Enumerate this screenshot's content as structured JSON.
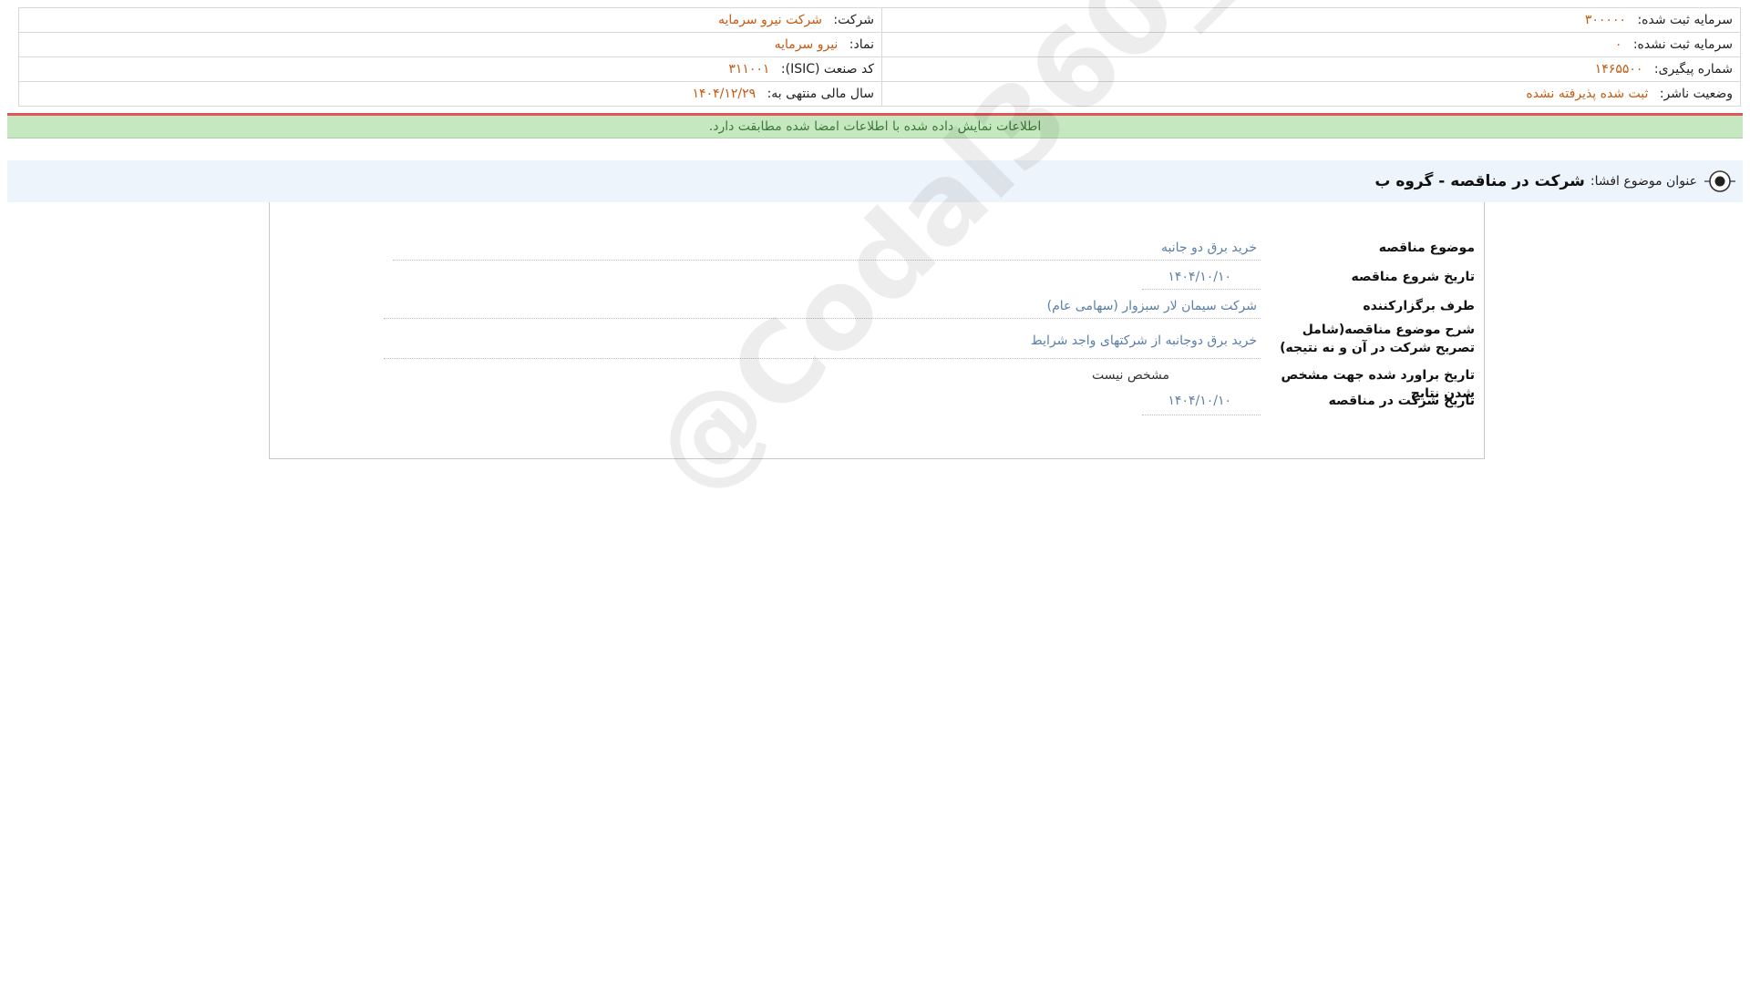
{
  "header": {
    "company_label": "شرکت:",
    "company_value": "شرکت نیرو سرمایه",
    "symbol_label": "نماد:",
    "symbol_value": "نیرو سرمایه",
    "isic_label": "کد صنعت (ISIC):",
    "isic_value": "۳۱۱۰۰۱",
    "fiscal_label": "سال مالی منتهی به:",
    "fiscal_value": "۱۴۰۴/۱۲/۲۹",
    "registered_capital_label": "سرمایه ثبت شده:",
    "registered_capital_value": "۳۰۰۰۰۰",
    "unregistered_capital_label": "سرمایه ثبت نشده:",
    "unregistered_capital_value": "۰",
    "tracking_label": "شماره پیگیری:",
    "tracking_value": "۱۴۶۵۵۰۰",
    "publisher_status_label": "وضعیت ناشر:",
    "publisher_status_value": "ثبت شده پذیرفته نشده"
  },
  "notice": {
    "text": "اطلاعات نمایش داده شده با اطلاعات امضا شده مطابقت دارد."
  },
  "subject": {
    "label": "عنوان موضوع افشا:",
    "title": "شرکت در مناقصه - گروه ب"
  },
  "details": [
    {
      "label": "موضوع مناقصه",
      "value": "خرید برق دو جانبه"
    },
    {
      "label": "تاریخ شروع مناقصه",
      "value": "۱۴۰۴/۱۰/۱۰"
    },
    {
      "label": "طرف برگزارکننده",
      "value": "شرکت سیمان لار سبزوار (سهامی عام)"
    },
    {
      "label": "شرح موضوع مناقصه(شامل تصریح شرکت در آن و نه نتیجه)",
      "value": "خرید برق دوجانبه از شرکتهای واجد شرایط"
    },
    {
      "label": "تاریخ براورد شده جهت مشخص شدن نتایج",
      "value": "مشخص نیست"
    },
    {
      "label": "تاریخ شرکت در مناقصه",
      "value": "۱۴۰۴/۱۰/۱۰"
    }
  ],
  "watermark": "@Codal360_ir",
  "colors": {
    "value_orange": "#c55a11",
    "value_blue": "#5b7fa6",
    "notice_bg": "#c6e8c1",
    "notice_border": "#e0555a",
    "subject_bg": "#eef4fb"
  }
}
